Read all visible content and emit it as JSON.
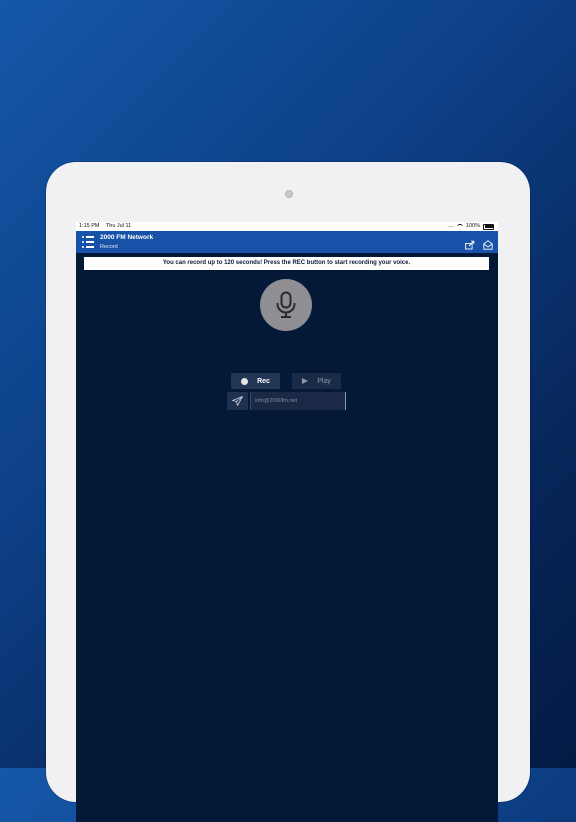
{
  "status": {
    "time": "1:15 PM",
    "date": "Thu Jul 11",
    "dots": "....",
    "battery_pct": "100%"
  },
  "nav": {
    "title": "2000 FM Network",
    "subtitle": "Record"
  },
  "banner": {
    "text": "You can record up to 120 seconds! Press the REC button to start recording your voice."
  },
  "controls": {
    "rec_label": "Rec",
    "play_label": "Play"
  },
  "email": {
    "placeholder": "info@2000fm.net",
    "value": ""
  },
  "icons": {
    "menu": "list-menu-icon",
    "share": "share-icon",
    "mail": "mail-icon",
    "mic": "microphone-icon",
    "rec": "record-dot-icon",
    "play": "play-icon",
    "send": "send-icon"
  },
  "colors": {
    "nav_bar": "#1852a8",
    "screen_bg": "#041838",
    "mic_circle": "#8f8f93"
  }
}
